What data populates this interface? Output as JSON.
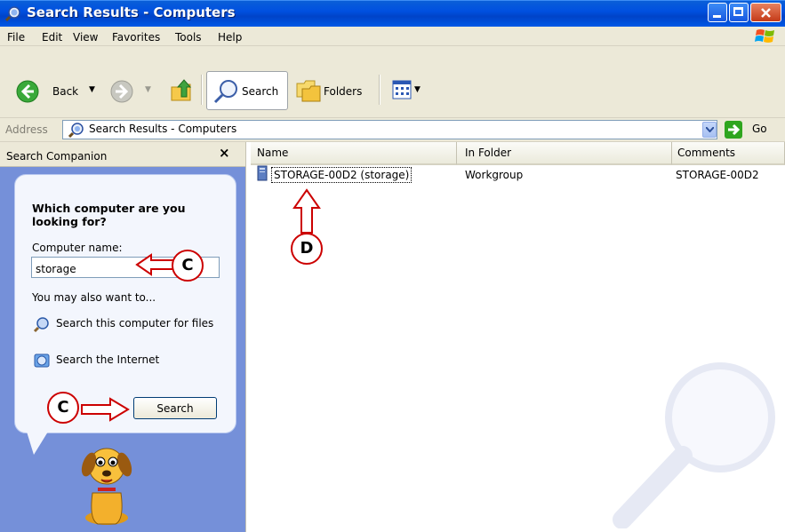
{
  "window": {
    "title": "Search Results - Computers"
  },
  "menu": [
    "File",
    "Edit",
    "View",
    "Favorites",
    "Tools",
    "Help"
  ],
  "toolbar": {
    "back": "Back",
    "search": "Search",
    "folders": "Folders"
  },
  "address": {
    "label": "Address",
    "value": "Search Results - Computers",
    "go": "Go"
  },
  "search_companion": {
    "title": "Search Companion",
    "close": "×",
    "question": "Which computer are you looking for?",
    "computer_name_label": "Computer name:",
    "computer_name_value": "storage",
    "also_label": "You may also want to...",
    "links": [
      "Search this computer for files",
      "Search the Internet"
    ],
    "search_button": "Search"
  },
  "results": {
    "columns": [
      "Name",
      "In Folder",
      "Comments"
    ],
    "rows": [
      {
        "name": "STORAGE-00D2 (storage)",
        "folder": "Workgroup",
        "comments": "STORAGE-00D2"
      }
    ]
  },
  "annotations": {
    "c_field": "C",
    "c_button": "C",
    "d_result": "D"
  },
  "colors": {
    "titlebar": "#0054e3",
    "pane": "#7590d9",
    "annotation": "#cc0000"
  }
}
